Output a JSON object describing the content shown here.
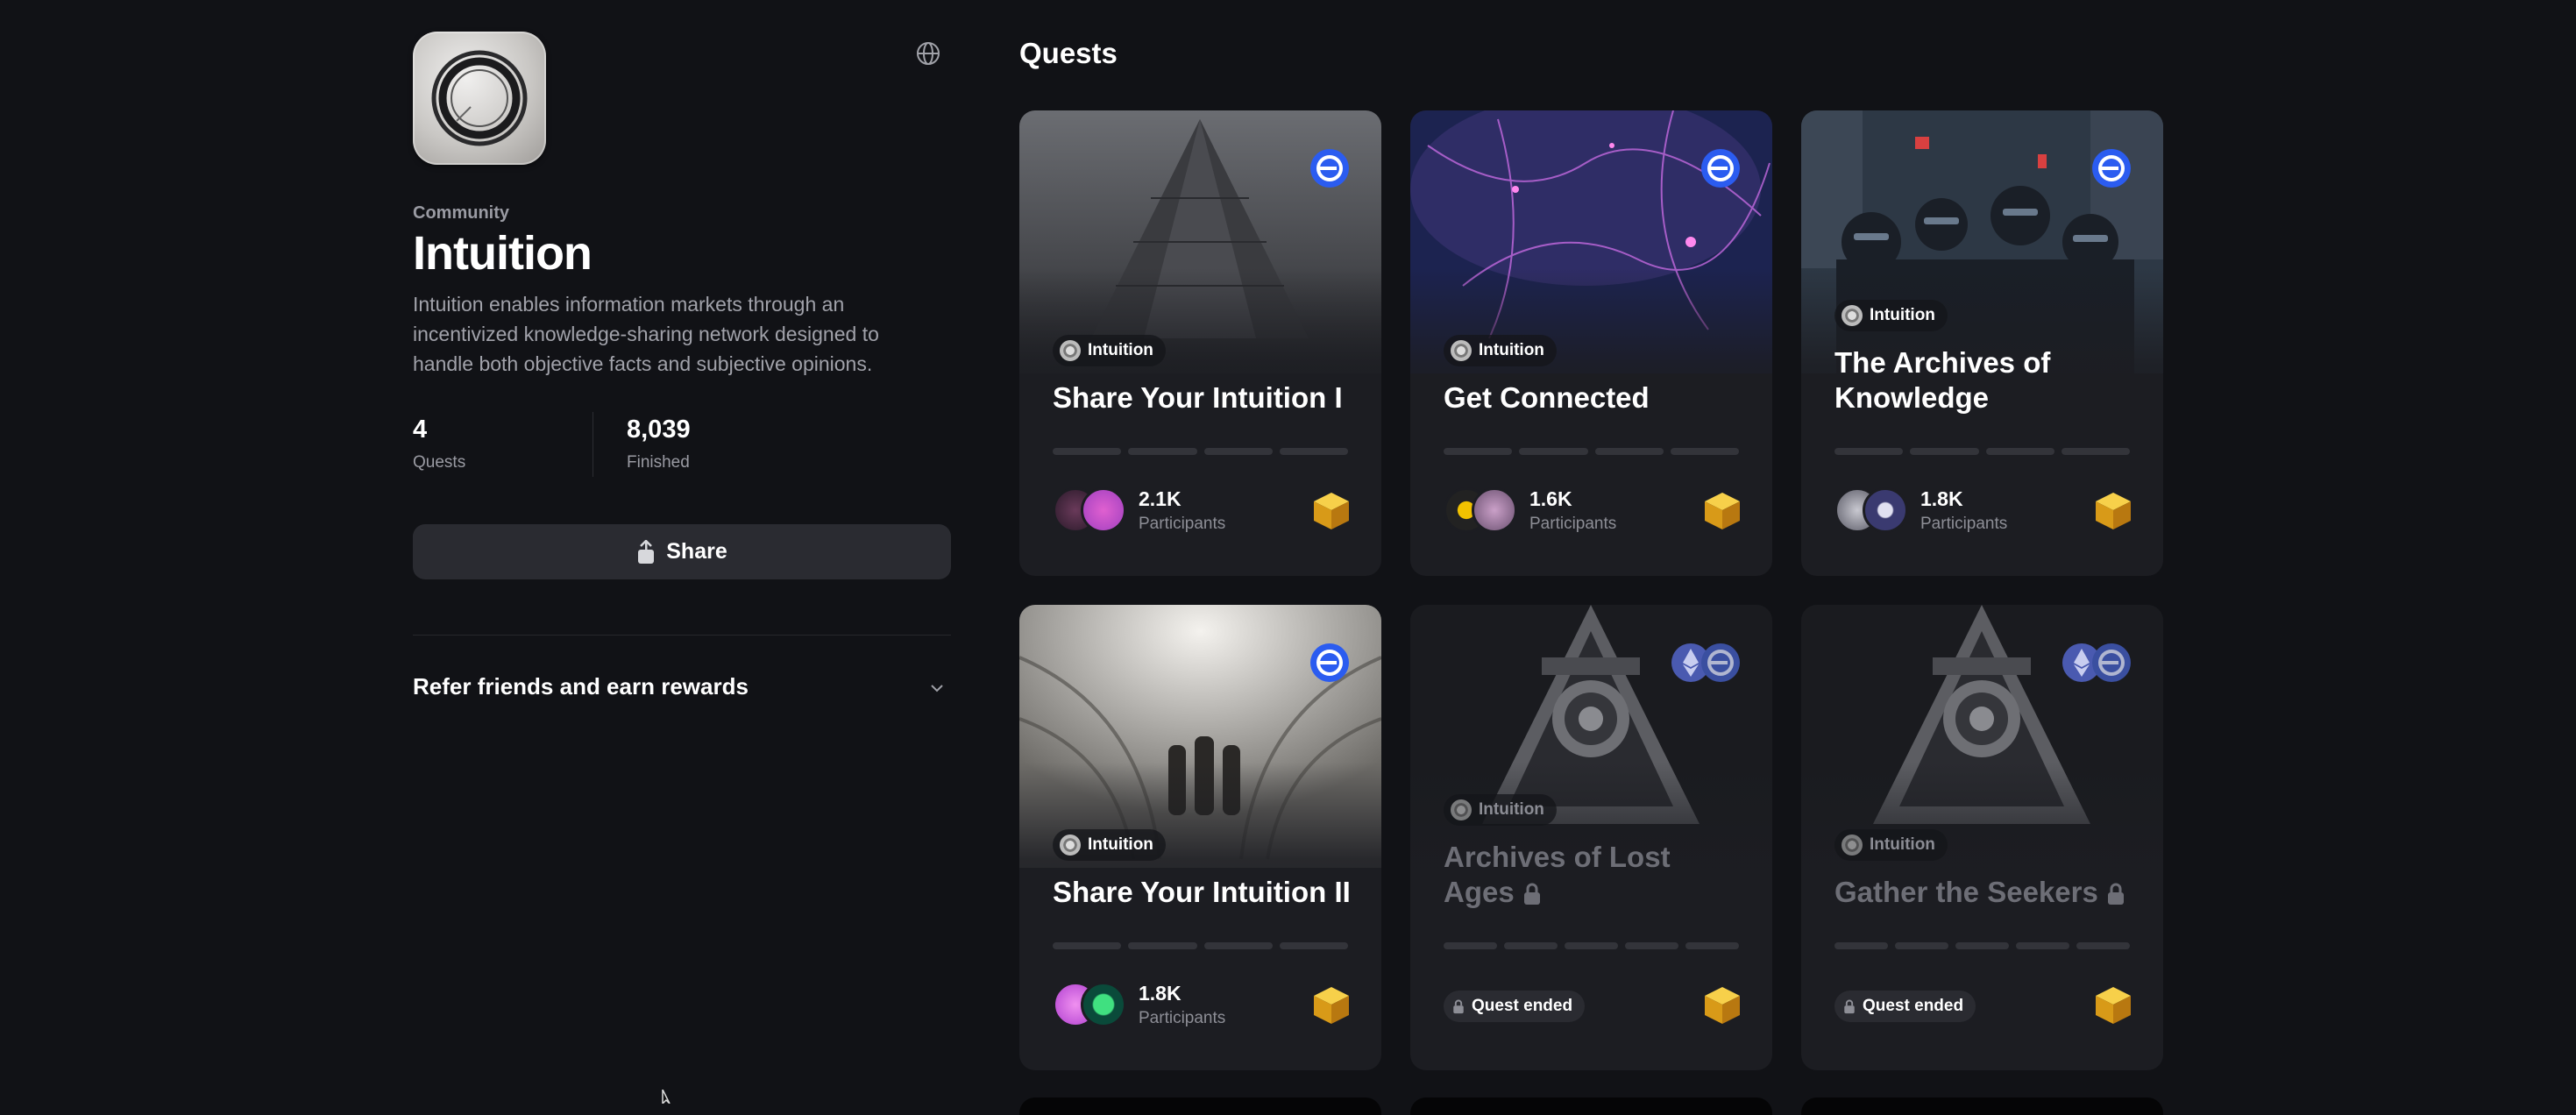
{
  "community": {
    "tag": "Community",
    "name": "Intuition",
    "description": "Intuition enables information markets through an incentivized knowledge-sharing network designed to handle both objective facts and subjective opinions.",
    "stats": [
      {
        "value": "4",
        "label": "Quests"
      },
      {
        "value": "8,039",
        "label": "Finished"
      }
    ],
    "share_label": "Share",
    "refer_label": "Refer friends and earn rewards"
  },
  "quests": {
    "heading": "Quests",
    "cards": [
      {
        "community": "Intuition",
        "title": "Share Your Intuition I",
        "participants": "2.1K",
        "participants_label": "Participants",
        "status": "active",
        "progress_segments": 4
      },
      {
        "community": "Intuition",
        "title": "Get Connected",
        "participants": "1.6K",
        "participants_label": "Participants",
        "status": "active",
        "progress_segments": 4
      },
      {
        "community": "Intuition",
        "title": "The Archives of Knowledge",
        "participants": "1.8K",
        "participants_label": "Participants",
        "status": "active",
        "progress_segments": 4
      },
      {
        "community": "Intuition",
        "title": "Share Your Intuition II",
        "participants": "1.8K",
        "participants_label": "Participants",
        "status": "active",
        "progress_segments": 4
      },
      {
        "community": "Intuition",
        "title": "Archives of Lost Ages",
        "ended_label": "Quest ended",
        "status": "ended",
        "progress_segments": 5
      },
      {
        "community": "Intuition",
        "title": "Gather the Seekers",
        "ended_label": "Quest ended",
        "status": "ended",
        "progress_segments": 5
      }
    ]
  },
  "icons": {
    "globe": "globe-icon",
    "share": "share-icon",
    "chevron": "chevron-down-icon",
    "chain": "base-chain-icon",
    "eth": "ethereum-icon",
    "reward": "reward-cube-icon",
    "lock": "lock-icon"
  },
  "colors": {
    "background": "#111216",
    "card": "#1c1d22",
    "accent_chain": "#2b5cf0",
    "reward_cube": "#e8b022"
  }
}
